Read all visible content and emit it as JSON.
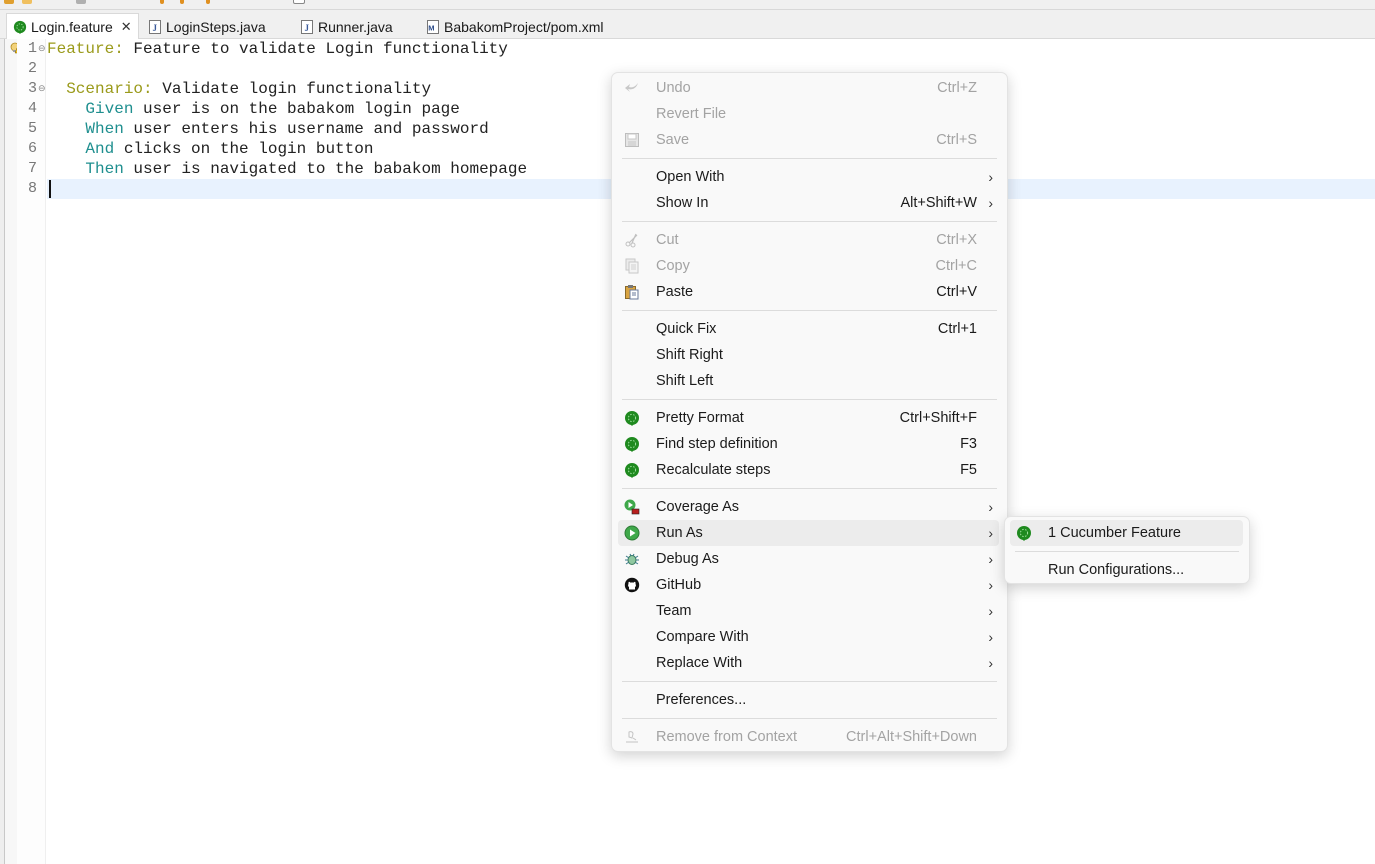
{
  "tabs": [
    {
      "label": "Login.feature",
      "icon": "cucumber-icon",
      "active": true,
      "closable": true
    },
    {
      "label": "LoginSteps.java",
      "icon": "java-file-icon",
      "active": false
    },
    {
      "label": "Runner.java",
      "icon": "java-file-icon",
      "active": false
    },
    {
      "label": "BabakomProject/pom.xml",
      "icon": "maven-file-icon",
      "active": false
    }
  ],
  "tab_close_glyph": "✕",
  "editor": {
    "current_line": 8,
    "lines": [
      {
        "num": "1",
        "keyword": "Feature:",
        "text": " Feature to validate Login functionality",
        "indent": "",
        "kind": "feature",
        "fold": "⊖"
      },
      {
        "num": "2",
        "keyword": "",
        "text": "",
        "indent": "",
        "kind": "plain",
        "fold": ""
      },
      {
        "num": "3",
        "keyword": "Scenario:",
        "text": " Validate login functionality",
        "indent": "  ",
        "kind": "feature",
        "fold": "⊖"
      },
      {
        "num": "4",
        "keyword": "Given",
        "text": " user is on the babakom login page",
        "indent": "    ",
        "kind": "step",
        "fold": ""
      },
      {
        "num": "5",
        "keyword": "When",
        "text": " user enters his username and password",
        "indent": "    ",
        "kind": "step",
        "fold": ""
      },
      {
        "num": "6",
        "keyword": "And",
        "text": " clicks on the login button",
        "indent": "    ",
        "kind": "step",
        "fold": ""
      },
      {
        "num": "7",
        "keyword": "Then",
        "text": " user is navigated to the babakom homepage",
        "indent": "    ",
        "kind": "step",
        "fold": ""
      },
      {
        "num": "8",
        "keyword": "",
        "text": "",
        "indent": "",
        "kind": "plain",
        "fold": ""
      }
    ]
  },
  "context_menu": {
    "items": [
      {
        "label": "Undo",
        "accel": "Ctrl+Z",
        "icon": "undo-icon",
        "disabled": true,
        "submenu": false
      },
      {
        "label": "Revert File",
        "accel": "",
        "icon": "",
        "disabled": true,
        "submenu": false
      },
      {
        "label": "Save",
        "accel": "Ctrl+S",
        "icon": "save-icon",
        "disabled": true,
        "submenu": false
      },
      {
        "sep": true
      },
      {
        "label": "Open With",
        "accel": "",
        "icon": "",
        "disabled": false,
        "submenu": true
      },
      {
        "label": "Show In",
        "accel": "Alt+Shift+W",
        "icon": "",
        "disabled": false,
        "submenu": true
      },
      {
        "sep": true
      },
      {
        "label": "Cut",
        "accel": "Ctrl+X",
        "icon": "cut-icon",
        "disabled": true,
        "submenu": false
      },
      {
        "label": "Copy",
        "accel": "Ctrl+C",
        "icon": "copy-icon",
        "disabled": true,
        "submenu": false
      },
      {
        "label": "Paste",
        "accel": "Ctrl+V",
        "icon": "paste-icon",
        "disabled": false,
        "submenu": false
      },
      {
        "sep": true
      },
      {
        "label": "Quick Fix",
        "accel": "Ctrl+1",
        "icon": "",
        "disabled": false,
        "submenu": false
      },
      {
        "label": "Shift Right",
        "accel": "",
        "icon": "",
        "disabled": false,
        "submenu": false
      },
      {
        "label": "Shift Left",
        "accel": "",
        "icon": "",
        "disabled": false,
        "submenu": false
      },
      {
        "sep": true
      },
      {
        "label": "Pretty Format",
        "accel": "Ctrl+Shift+F",
        "icon": "cucumber-icon",
        "disabled": false,
        "submenu": false
      },
      {
        "label": "Find step definition",
        "accel": "F3",
        "icon": "cucumber-icon",
        "disabled": false,
        "submenu": false
      },
      {
        "label": "Recalculate steps",
        "accel": "F5",
        "icon": "cucumber-icon",
        "disabled": false,
        "submenu": false
      },
      {
        "sep": true
      },
      {
        "label": "Coverage As",
        "accel": "",
        "icon": "coverage-icon",
        "disabled": false,
        "submenu": true
      },
      {
        "label": "Run As",
        "accel": "",
        "icon": "run-icon",
        "disabled": false,
        "submenu": true,
        "hover": true
      },
      {
        "label": "Debug As",
        "accel": "",
        "icon": "debug-bug-icon",
        "disabled": false,
        "submenu": true
      },
      {
        "label": "GitHub",
        "accel": "",
        "icon": "github-icon",
        "disabled": false,
        "submenu": true
      },
      {
        "label": "Team",
        "accel": "",
        "icon": "",
        "disabled": false,
        "submenu": true
      },
      {
        "label": "Compare With",
        "accel": "",
        "icon": "",
        "disabled": false,
        "submenu": true
      },
      {
        "label": "Replace With",
        "accel": "",
        "icon": "",
        "disabled": false,
        "submenu": true
      },
      {
        "sep": true
      },
      {
        "label": "Preferences...",
        "accel": "",
        "icon": "",
        "disabled": false,
        "submenu": false
      },
      {
        "sep": true
      },
      {
        "label": "Remove from Context",
        "accel": "Ctrl+Alt+Shift+Down",
        "icon": "remove-context-icon",
        "disabled": true,
        "submenu": false
      }
    ],
    "arrow_glyph": "›"
  },
  "run_as_submenu": {
    "items": [
      {
        "label": "1 Cucumber Feature",
        "icon": "cucumber-icon",
        "hover": true
      },
      {
        "sep": true
      },
      {
        "label": "Run Configurations...",
        "icon": ""
      }
    ]
  },
  "colors": {
    "cucumber_green": "#1f8a1f",
    "feature_keyword": "#9a9a1a",
    "step_keyword": "#1f8f8f",
    "current_line": "#e8f2fe",
    "menu_bg": "#f9f9f9",
    "disabled_text": "#a3a3a3"
  }
}
